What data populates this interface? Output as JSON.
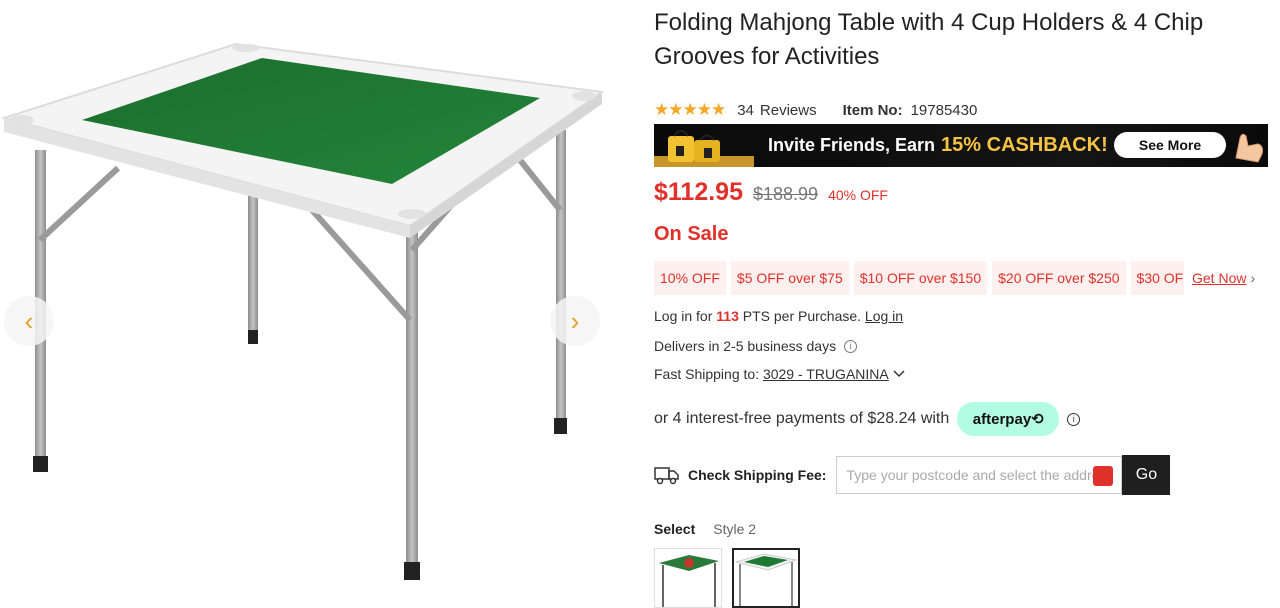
{
  "gallery": {
    "prev_icon": "chevron-left-icon",
    "next_icon": "chevron-right-icon",
    "prev_glyph": "‹",
    "next_glyph": "›"
  },
  "product": {
    "title": "Folding Mahjong Table with 4 Cup Holders & 4 Chip Grooves for Activities",
    "rating_stars": "★★★★★",
    "reviews_count": "34",
    "reviews_label": "Reviews",
    "item_no_label": "Item No:",
    "item_no": "19785430"
  },
  "banner": {
    "text": "Invite Friends, Earn",
    "highlight": "15% CASHBACK!",
    "button": "See More"
  },
  "pricing": {
    "price": "$112.95",
    "old_price": "$188.99",
    "discount": "40% OFF",
    "on_sale": "On Sale"
  },
  "coupons": {
    "items": [
      "10% OFF",
      "$5 OFF over $75",
      "$10 OFF over $150",
      "$20 OFF over $250",
      "$30 OF"
    ],
    "get_now": "Get Now",
    "get_now_arrow": "›"
  },
  "points": {
    "prefix": "Log in for",
    "value": "113",
    "suffix": "PTS per Purchase.",
    "login": "Log in"
  },
  "delivery": {
    "text": "Delivers in 2-5 business days",
    "info_icon": "ⓘ"
  },
  "shipping_to": {
    "label": "Fast Shipping to:",
    "location": "3029 - TRUGANINA",
    "chevron": "⌄"
  },
  "afterpay": {
    "text": "or 4 interest-free payments of $28.24 with",
    "badge": "afterpay⟲"
  },
  "shipping_fee": {
    "label": "Check Shipping Fee:",
    "placeholder": "Type your postcode and select the address",
    "button": "Go"
  },
  "style_select": {
    "label": "Select",
    "value": "Style 2"
  },
  "colors": {
    "accent_red": "#e0312b",
    "star": "#f5a623",
    "felt_green": "#1e7a33",
    "afterpay_mint": "#b2fce4"
  }
}
